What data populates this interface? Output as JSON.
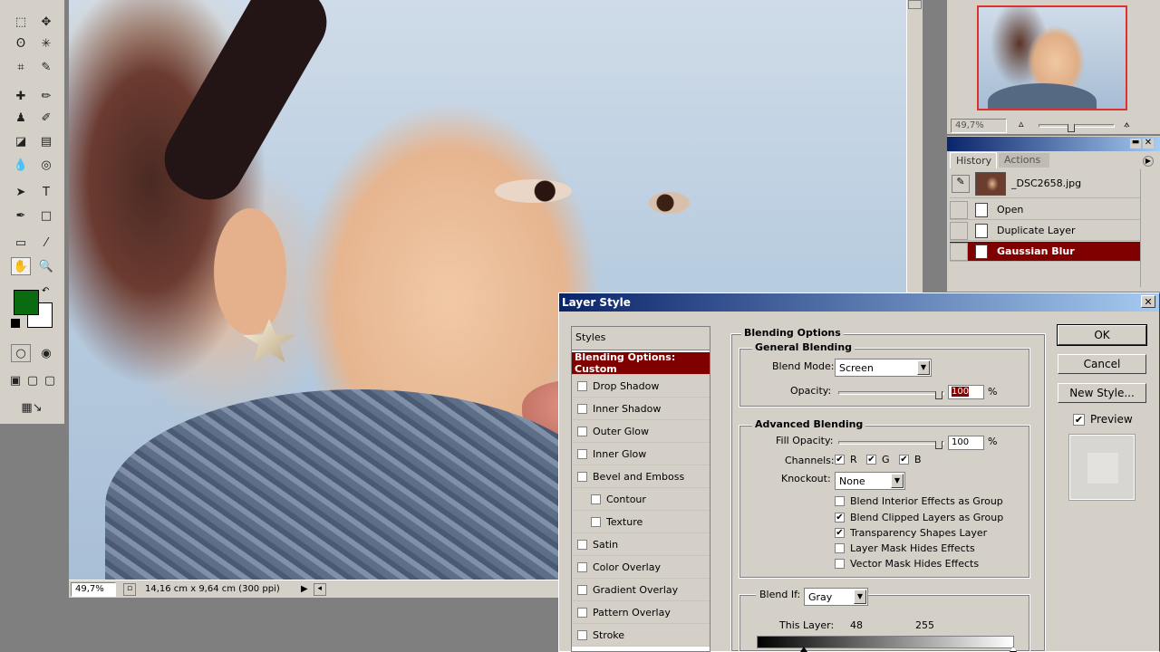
{
  "canvas": {
    "zoom": "49,7%",
    "doc_info": "14,16 cm x 9,64 cm (300 ppi)"
  },
  "navigator": {
    "zoom": "49,7%"
  },
  "history": {
    "tabs": [
      "History",
      "Actions"
    ],
    "snapshot": "_DSC2658.jpg",
    "steps": [
      "Open",
      "Duplicate Layer",
      "Gaussian Blur"
    ],
    "selected": "Gaussian Blur"
  },
  "colors": {
    "foreground": "#0a6b10",
    "background": "#ffffff",
    "selected": "#800000",
    "titlebar": "#0a246a"
  },
  "layer_style": {
    "title": "Layer Style",
    "styles_header": "Styles",
    "styles": [
      {
        "label": "Blending Options: Custom",
        "selected": true
      },
      {
        "label": "Drop Shadow",
        "checked": false
      },
      {
        "label": "Inner Shadow",
        "checked": false
      },
      {
        "label": "Outer Glow",
        "checked": false
      },
      {
        "label": "Inner Glow",
        "checked": false
      },
      {
        "label": "Bevel and Emboss",
        "checked": false
      },
      {
        "label": "Contour",
        "checked": false
      },
      {
        "label": "Texture",
        "checked": false
      },
      {
        "label": "Satin",
        "checked": false
      },
      {
        "label": "Color Overlay",
        "checked": false
      },
      {
        "label": "Gradient Overlay",
        "checked": false
      },
      {
        "label": "Pattern Overlay",
        "checked": false
      },
      {
        "label": "Stroke",
        "checked": false
      }
    ],
    "blending_options": "Blending Options",
    "general": {
      "title": "General Blending",
      "blend_mode_label": "Blend Mode:",
      "blend_mode": "Screen",
      "opacity_label": "Opacity:",
      "opacity": "100",
      "opacity_level": 1.0,
      "pct": "%"
    },
    "advanced": {
      "title": "Advanced Blending",
      "fill_label": "Fill Opacity:",
      "fill": "100",
      "fill_level": 1.0,
      "channels_label": "Channels:",
      "channels": [
        "R",
        "G",
        "B"
      ],
      "knockout_label": "Knockout:",
      "knockout": "None",
      "options": [
        {
          "label": "Blend Interior Effects as Group",
          "checked": false
        },
        {
          "label": "Blend Clipped Layers as Group",
          "checked": true
        },
        {
          "label": "Transparency Shapes Layer",
          "checked": true
        },
        {
          "label": "Layer Mask Hides Effects",
          "checked": false
        },
        {
          "label": "Vector Mask Hides Effects",
          "checked": false
        }
      ]
    },
    "blend_if": {
      "label": "Blend If:",
      "value": "Gray",
      "this_layer_label": "This Layer:",
      "low": "48",
      "high": "255"
    },
    "buttons": {
      "ok": "OK",
      "cancel": "Cancel",
      "new_style": "New Style...",
      "preview": "Preview"
    }
  }
}
